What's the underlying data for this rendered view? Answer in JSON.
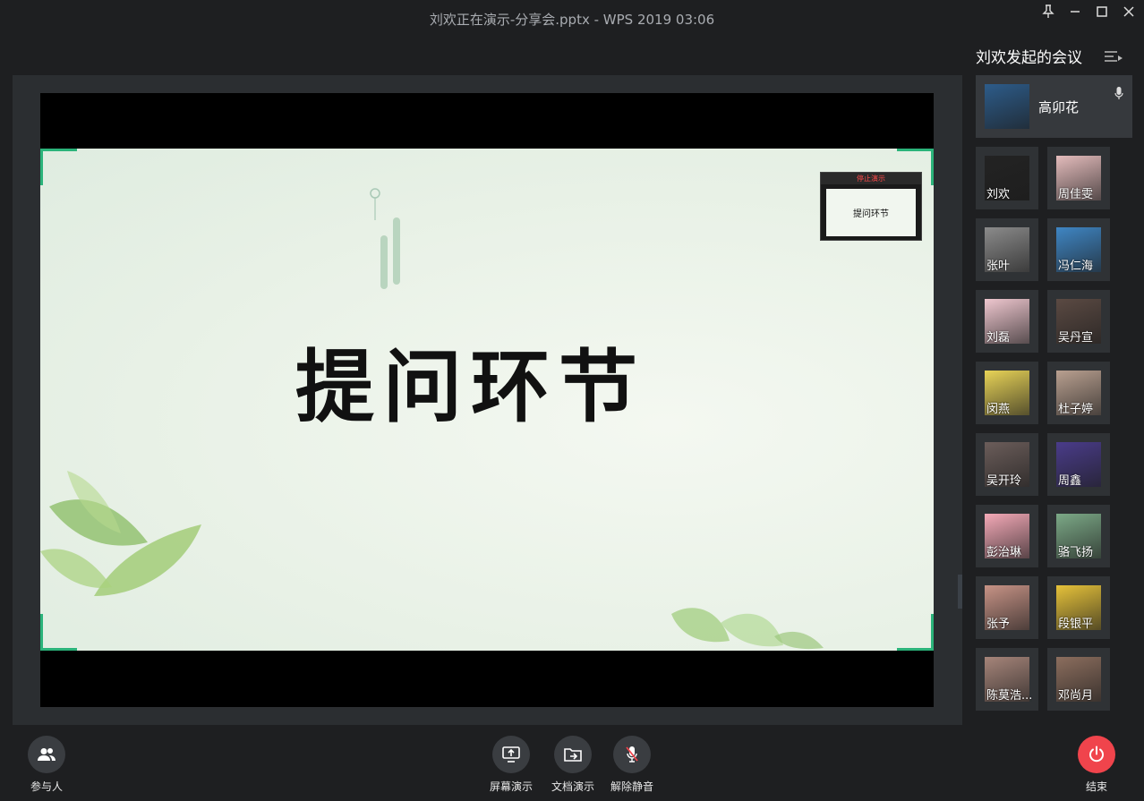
{
  "window": {
    "title": "刘欢正在演示-分享会.pptx - WPS 2019 03:06"
  },
  "slide": {
    "heading": "提问环节",
    "thumbnail_bar": "停止演示",
    "thumbnail_text": "提问环节"
  },
  "sidebar": {
    "title": "刘欢发起的会议",
    "host": {
      "name": "高卯花",
      "color": "#2d5c8a"
    },
    "participants": [
      {
        "name": "刘欢",
        "color": "#232323"
      },
      {
        "name": "周佳雯",
        "color": "#e4bcbc"
      },
      {
        "name": "张叶",
        "color": "#8b8b8b"
      },
      {
        "name": "冯仁海",
        "color": "#3f86c4"
      },
      {
        "name": "刘磊",
        "color": "#efc7cf"
      },
      {
        "name": "吴丹宣",
        "color": "#5b4a43"
      },
      {
        "name": "闵燕",
        "color": "#e8d357"
      },
      {
        "name": "杜子婷",
        "color": "#b9a090"
      },
      {
        "name": "吴开玲",
        "color": "#6b5d5a"
      },
      {
        "name": "周鑫",
        "color": "#4a3c8a"
      },
      {
        "name": "彭治琳",
        "color": "#f4a9b7"
      },
      {
        "name": "骆飞扬",
        "color": "#7ca987"
      },
      {
        "name": "张予",
        "color": "#c79386"
      },
      {
        "name": "段银平",
        "color": "#e6c23a"
      },
      {
        "name": "陈莫浩...",
        "color": "#a6857a"
      },
      {
        "name": "邓尚月",
        "color": "#8c6e5e"
      }
    ]
  },
  "toolbar": {
    "participants_label": "参与人",
    "screen_share_label": "屏幕演示",
    "doc_share_label": "文档演示",
    "unmute_label": "解除静音",
    "end_label": "结束",
    "end_color": "#f0444c"
  }
}
